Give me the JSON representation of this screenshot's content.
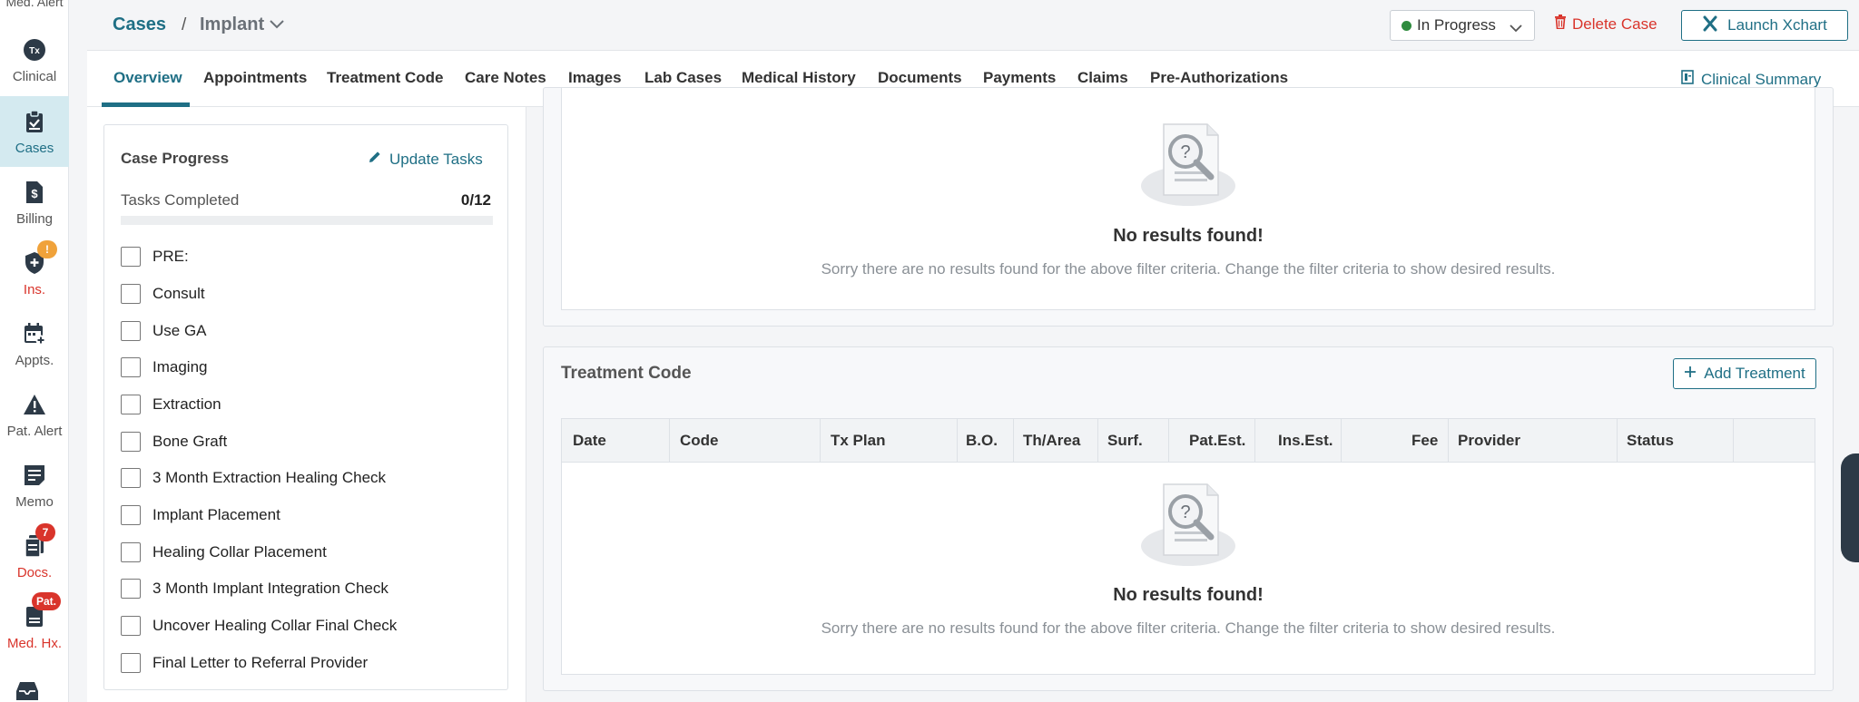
{
  "sidebar": {
    "top_cut_label": "Med. Alert",
    "items": [
      {
        "label": "Clinical",
        "icon": "tx-clinical-icon",
        "badge": ""
      },
      {
        "label": "Cases",
        "icon": "clipboard-icon",
        "badge": ""
      },
      {
        "label": "Billing",
        "icon": "invoice-icon",
        "badge": ""
      },
      {
        "label": "Ins.",
        "icon": "shield-plus-icon",
        "badge": "!"
      },
      {
        "label": "Appts.",
        "icon": "calendar-plus-icon",
        "badge": ""
      },
      {
        "label": "Pat. Alert",
        "icon": "alert-triangle-icon",
        "badge": ""
      },
      {
        "label": "Memo",
        "icon": "memo-icon",
        "badge": ""
      },
      {
        "label": "Docs.",
        "icon": "documents-icon",
        "badge": "7"
      },
      {
        "label": "Med. Hx.",
        "icon": "medical-history-icon",
        "badge": "Pat."
      }
    ],
    "colors": {
      "active_bg": "#d4eaf0",
      "badge_orange": "#f0a23a",
      "badge_red": "#d9342b"
    }
  },
  "header": {
    "breadcrumb_root": "Cases",
    "breadcrumb_sep": "/",
    "breadcrumb_current": "Implant",
    "status": "In Progress",
    "delete_label": "Delete Case",
    "launch_label": "Launch Xchart"
  },
  "tabs": {
    "items": [
      "Overview",
      "Appointments",
      "Treatment Code",
      "Care Notes",
      "Images",
      "Lab Cases",
      "Medical History",
      "Documents",
      "Payments",
      "Claims",
      "Pre-Authorizations"
    ],
    "active": "Overview",
    "clinical_summary": "Clinical Summary"
  },
  "case_progress": {
    "title": "Case Progress",
    "update_label": "Update Tasks",
    "tasks_label": "Tasks Completed",
    "count": "0/12",
    "progress": 0,
    "tasks": [
      "PRE:",
      "Consult",
      "Use GA",
      "Imaging",
      "Extraction",
      "Bone Graft",
      "3 Month Extraction Healing Check",
      "Implant Placement",
      "Healing Collar Placement",
      "3 Month Implant Integration Check",
      "Uncover Healing Collar Final Check",
      "Final Letter to Referral Provider"
    ]
  },
  "top_section": {
    "empty_title": "No results found!",
    "empty_sub": "Sorry there are no results found for the above filter criteria. Change the filter criteria to show desired results."
  },
  "treatment_code": {
    "title": "Treatment Code",
    "add_label": "Add Treatment",
    "columns": [
      "Date",
      "Code",
      "Tx Plan",
      "B.O.",
      "Th/Area",
      "Surf.",
      "Pat.Est.",
      "Ins.Est.",
      "Fee",
      "Provider",
      "Status"
    ],
    "empty_title": "No results found!",
    "empty_sub": "Sorry there are no results found for the above filter criteria. Change the filter criteria to show desired results."
  },
  "accent": "#1f6f85"
}
